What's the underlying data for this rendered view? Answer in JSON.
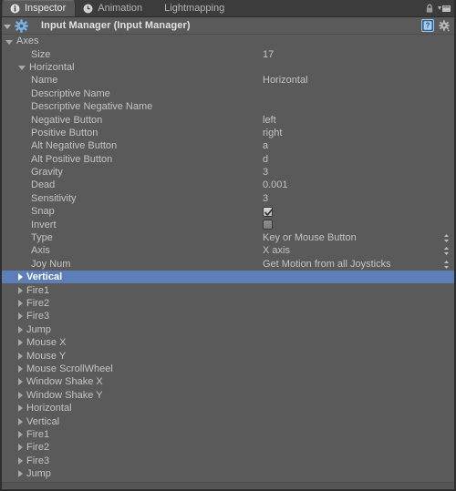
{
  "window": {
    "background_color": "#5a5a5a",
    "tabbar_color": "#3c3c3c",
    "selection_color": "#5d7fb8",
    "text_color": "#c4c4c4"
  },
  "tabbar": {
    "tabs": [
      {
        "label": "Inspector",
        "icon": "info-circle-icon",
        "active": true
      },
      {
        "label": "Animation",
        "icon": "clock-icon",
        "active": false
      },
      {
        "label": "Lightmapping",
        "icon": "",
        "active": false
      }
    ],
    "lock_icon": "lock-icon",
    "menu_icon": "tab-menu-icon"
  },
  "component_header": {
    "foldout_state": "open",
    "icon": "input-manager-gear-icon",
    "title": "Input Manager (Input Manager)",
    "help_icon": "help-book-icon",
    "settings_icon": "settings-gear-icon"
  },
  "axes": {
    "foldout_label": "Axes",
    "foldout_state": "open",
    "size_label": "Size",
    "size_value": "17"
  },
  "expanded_axis": {
    "name": "Horizontal",
    "foldout_state": "open",
    "properties": [
      {
        "label": "Name",
        "value": "Horizontal",
        "kind": "text"
      },
      {
        "label": "Descriptive Name",
        "value": "",
        "kind": "text"
      },
      {
        "label": "Descriptive Negative Name",
        "value": "",
        "kind": "text"
      },
      {
        "label": "Negative Button",
        "value": "left",
        "kind": "text"
      },
      {
        "label": "Positive Button",
        "value": "right",
        "kind": "text"
      },
      {
        "label": "Alt Negative Button",
        "value": "a",
        "kind": "text"
      },
      {
        "label": "Alt Positive Button",
        "value": "d",
        "kind": "text"
      },
      {
        "label": "Gravity",
        "value": "3",
        "kind": "text"
      },
      {
        "label": "Dead",
        "value": "0.001",
        "kind": "text"
      },
      {
        "label": "Sensitivity",
        "value": "3",
        "kind": "text"
      },
      {
        "label": "Snap",
        "value": "checked",
        "kind": "checkbox"
      },
      {
        "label": "Invert",
        "value": "unchecked",
        "kind": "checkbox"
      },
      {
        "label": "Type",
        "value": "Key or Mouse Button",
        "kind": "popup"
      },
      {
        "label": "Axis",
        "value": "X axis",
        "kind": "popup"
      },
      {
        "label": "Joy Num",
        "value": "Get Motion from all Joysticks",
        "kind": "popup"
      }
    ]
  },
  "axis_list": [
    {
      "label": "Vertical",
      "selected": true
    },
    {
      "label": "Fire1",
      "selected": false
    },
    {
      "label": "Fire2",
      "selected": false
    },
    {
      "label": "Fire3",
      "selected": false
    },
    {
      "label": "Jump",
      "selected": false
    },
    {
      "label": "Mouse X",
      "selected": false
    },
    {
      "label": "Mouse Y",
      "selected": false
    },
    {
      "label": "Mouse ScrollWheel",
      "selected": false
    },
    {
      "label": "Window Shake X",
      "selected": false
    },
    {
      "label": "Window Shake Y",
      "selected": false
    },
    {
      "label": "Horizontal",
      "selected": false
    },
    {
      "label": "Vertical",
      "selected": false
    },
    {
      "label": "Fire1",
      "selected": false
    },
    {
      "label": "Fire2",
      "selected": false
    },
    {
      "label": "Fire3",
      "selected": false
    },
    {
      "label": "Jump",
      "selected": false
    }
  ]
}
